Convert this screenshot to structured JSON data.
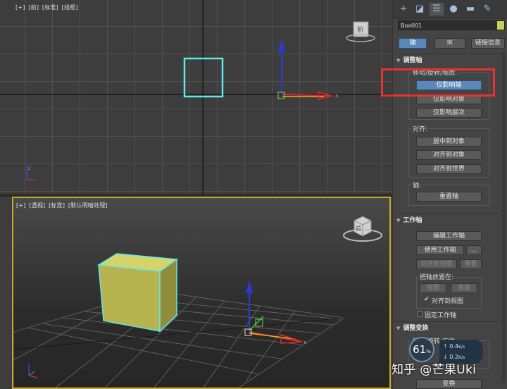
{
  "front_viewport": {
    "label_parts": [
      "[+]",
      "[前]",
      "[标准]",
      "[线框]"
    ],
    "cube_label": "前"
  },
  "persp_viewport": {
    "label_parts": [
      "[+]",
      "[透视]",
      "[标准]",
      "[默认明暗处理]"
    ],
    "cube_label": "前"
  },
  "panel": {
    "object_name": "Box001",
    "object_color": "#c8cf5a",
    "top_tabs": [
      "轴",
      "IK",
      "链接信息"
    ],
    "adjust_pivot": {
      "title": "调整轴",
      "move_rotate_scale_label": "移动/旋转/缩放:",
      "buttons": [
        "仅影响轴",
        "仅影响对象",
        "仅影响层次"
      ],
      "align_label": "对齐:",
      "align_buttons": [
        "居中到对象",
        "对齐到对象",
        "对齐到世界"
      ],
      "axis_label": "轴:",
      "reset_button": "重置轴"
    },
    "working_pivot": {
      "title": "工作轴",
      "edit_button": "编辑工作轴",
      "use_button": "使用工作轴",
      "more_button": "...",
      "align_view_button": "对齐到视图",
      "reset_button": "重置",
      "place_label": "把轴放置在:",
      "view_button": "视图",
      "surface_button": "曲面",
      "align_to_view_check": "✔",
      "align_to_view_label": "对齐到视图",
      "fixed_label": "固定工作轴"
    },
    "adjust_transform": {
      "title": "调整变换",
      "move_label": "移动/旋转/缩放:",
      "transform_button": "变换"
    }
  },
  "overlay": {
    "speed_value": "61",
    "speed_unit": "%",
    "up_rate": "0.4",
    "up_unit": "K/s",
    "down_rate": "0.2",
    "down_unit": "K/s",
    "watermark": "知乎 @芒果Uki"
  },
  "colors": {
    "highlight": "#e8322e",
    "selection_cyan": "#5ee8e8",
    "active_button": "#5b88b8",
    "box_yellow": "#c8c85a"
  }
}
